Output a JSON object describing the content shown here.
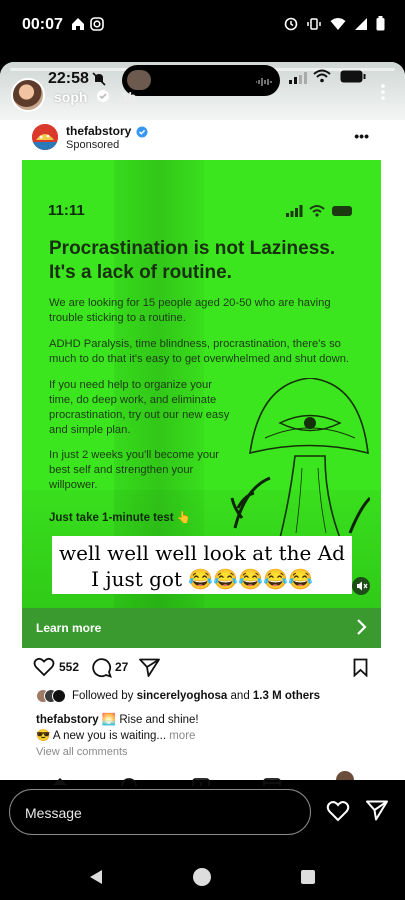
{
  "system_status": {
    "time": "00:07",
    "icons": [
      "home-icon",
      "instagram-icon",
      "sync-icon",
      "vibrate-icon",
      "wifi-icon",
      "signal-icon",
      "battery-icon"
    ]
  },
  "story": {
    "username": "soph",
    "age": "1h",
    "inner_screen_time": "22:58"
  },
  "post": {
    "account": "thefabstory",
    "sponsored_label": "Sponsored",
    "ad": {
      "time": "11:11",
      "headline_line1": "Procrastination is not Laziness.",
      "headline_line2": "It's a lack of routine.",
      "paragraphs": [
        [
          "We are looking for 15 people aged 20-50 who are having",
          "trouble sticking to a routine."
        ],
        [
          "ADHD Paralysis, time blindness, procrastination, there's so",
          "much to do that it's easy to get overwhelmed and shut down."
        ],
        [
          "If you need help to organize your",
          "time, do deep work, and eliminate",
          "procrastination, try out our new easy",
          "and simple plan."
        ],
        [
          "In just 2 weeks you'll become your",
          "best self and strengthen your",
          "willpower."
        ]
      ],
      "cta_text": "Just take 1-minute test 👆"
    },
    "overlay_caption_line1": "well well well look at the Ad",
    "overlay_caption_line2": "I just got 😂😂😂😂😂",
    "learn_more_label": "Learn more",
    "likes": "552",
    "comments": "27",
    "followed_by_prefix": "Followed by ",
    "followed_by_user": "sincerelyoghosa",
    "followed_by_mid": " and ",
    "followed_by_count": "1.3 M others",
    "caption_user": "thefabstory",
    "caption_text": " 🌅 Rise and shine!",
    "caption_line2": "😎 A new you is waiting...",
    "caption_more": " more",
    "view_all_comments": "View all comments"
  },
  "reply": {
    "placeholder": "Message"
  },
  "colors": {
    "ad_green": "#3ce61e",
    "learn_bar": "#3a9a2f",
    "verified_blue": "#3897f0"
  }
}
